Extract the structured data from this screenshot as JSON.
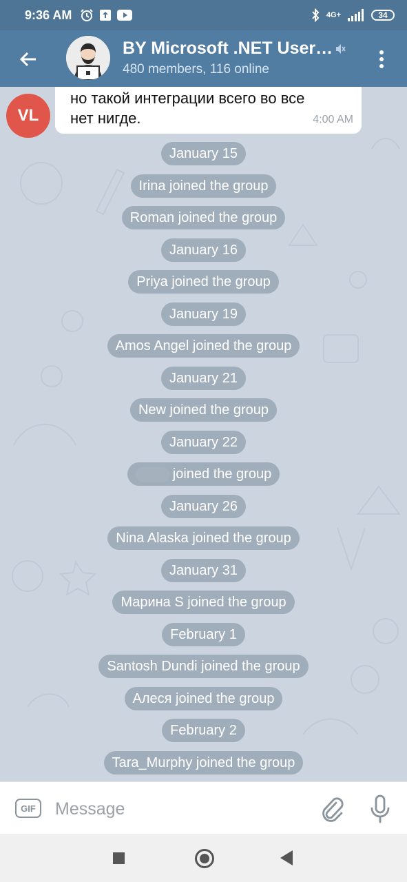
{
  "status_bar": {
    "time": "9:36 AM",
    "network": "4G+",
    "battery": "34",
    "icons": [
      "alarm-icon",
      "upload-icon",
      "youtube-icon",
      "bluetooth-icon",
      "signal-icon"
    ]
  },
  "header": {
    "title": "BY Microsoft .NET User Group",
    "subtitle": "480 members, 116 online",
    "muted": true
  },
  "message": {
    "sender_initials": "VL",
    "text": "но такой интеграции всего во все\nнет нигде.",
    "time": "4:00 AM",
    "avatar_color": "#e0564a"
  },
  "service_messages": [
    {
      "text": "January 15"
    },
    {
      "text": "Irina joined the group"
    },
    {
      "text": "Roman joined the group"
    },
    {
      "text": "January 16"
    },
    {
      "text": "Priya joined the group"
    },
    {
      "text": "January 19"
    },
    {
      "text": "Amos Angel joined the group"
    },
    {
      "text": "January 21"
    },
    {
      "text": "New joined the group"
    },
    {
      "text": "January 22"
    },
    {
      "text": "joined the group",
      "redacted_name": true
    },
    {
      "text": "January 26"
    },
    {
      "text": "Nina Alaska joined the group"
    },
    {
      "text": "January 31"
    },
    {
      "text": "Марина S joined the group"
    },
    {
      "text": "February 1"
    },
    {
      "text": "Santosh Dundi joined the group"
    },
    {
      "text": "Алеся joined the group"
    },
    {
      "text": "February 2"
    },
    {
      "text": "Tara_Murphy joined the group"
    }
  ],
  "input": {
    "gif_label": "GIF",
    "placeholder": "Message"
  },
  "colors": {
    "header": "#527da3",
    "status_bar": "#4e7595",
    "chat_background": "#ccd5df",
    "service_pill": "#96a4b2"
  }
}
